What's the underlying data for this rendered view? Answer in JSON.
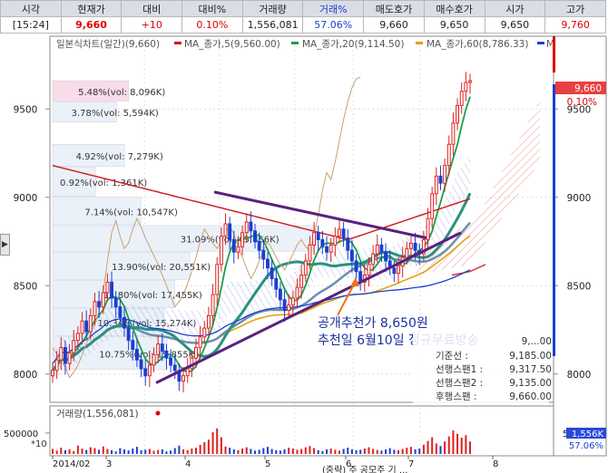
{
  "quote_bar": {
    "headers": [
      "시각",
      "현재가",
      "대비",
      "대비%",
      "거래량",
      "거래%",
      "매도호가",
      "매수호가",
      "시가",
      "고가"
    ],
    "values": [
      "[15:24]",
      "9,660",
      "+10",
      "0.10%",
      "1,556,081",
      "57.06%",
      "9,660",
      "9,650",
      "9,650",
      "9,760"
    ],
    "value_colors": [
      "#222222",
      "#e00000",
      "#e00000",
      "#e00000",
      "#222222",
      "#1a3fd0",
      "#222222",
      "#222222",
      "#222222",
      "#e00000"
    ]
  },
  "legend": {
    "items": [
      {
        "label": "일본식차트(일간)(9,660)",
        "color": "#666666"
      },
      {
        "label": "MA_종가,5(9,560.00)",
        "color": "#e00000"
      },
      {
        "label": "MA_종가,20(9,114.50)",
        "color": "#1aa04a"
      },
      {
        "label": "MA_종가,60(8,786.33)",
        "color": "#e0a000"
      },
      {
        "label": "M",
        "color": "#1a3fd0"
      }
    ]
  },
  "price_badge": {
    "price": "9,660",
    "pct": "0.10%"
  },
  "annotations": {
    "line1": "공개추천가 8,650원",
    "line2": "추천일 6월10일 정규무료방송"
  },
  "info_box": {
    "rows": [
      {
        "label": "",
        "value": "9,...00"
      },
      {
        "label": "기준선 :",
        "value": "9,185.00"
      },
      {
        "label": "선행스팬1 :",
        "value": "9,317.50"
      },
      {
        "label": "선행스팬2 :",
        "value": "9,135.00"
      },
      {
        "label": "후행스팬 :",
        "value": "9,660.00"
      }
    ]
  },
  "volume_panel": {
    "title": "거래량(1,556,081)",
    "multiplier": "*10",
    "badge_value": "1,556K",
    "badge_pct": "57.06%"
  },
  "x_labels": [
    "2014/02",
    "3",
    "4",
    "5",
    "6",
    "7",
    "8"
  ],
  "bottom_text": "(중략) 주 공모주 기 ...",
  "chart_data": {
    "type": "candlestick",
    "title": "",
    "ylim": [
      7850,
      9850
    ],
    "y_ticks": [
      8000,
      8500,
      9000,
      9500
    ],
    "y_tick_labels": [
      "8000",
      "8500",
      "9000",
      "9500"
    ],
    "volume_ticks": [
      500000
    ],
    "volume_tick_labels": [
      "500000"
    ],
    "volume_right_label": "500000",
    "volume_ylim": [
      0,
      800000
    ],
    "series_close": [
      8020,
      8080,
      8150,
      8060,
      8120,
      8190,
      8230,
      8300,
      8240,
      8330,
      8410,
      8380,
      8460,
      8520,
      8430,
      8380,
      8320,
      8260,
      8190,
      8140,
      8080,
      8030,
      7990,
      8050,
      8110,
      8170,
      8130,
      8090,
      8050,
      8020,
      7960,
      7990,
      8030,
      8090,
      8150,
      8210,
      8260,
      8330,
      8450,
      8620,
      8780,
      8850,
      8760,
      8690,
      8720,
      8800,
      8860,
      8810,
      8750,
      8700,
      8650,
      8600,
      8540,
      8480,
      8420,
      8360,
      8390,
      8430,
      8490,
      8560,
      8640,
      8730,
      8800,
      8760,
      8720,
      8690,
      8730,
      8780,
      8820,
      8770,
      8700,
      8640,
      8580,
      8520,
      8560,
      8620,
      8680,
      8730,
      8690,
      8640,
      8600,
      8570,
      8610,
      8660,
      8710,
      8740,
      8700,
      8680,
      8760,
      8880,
      9020,
      9120,
      9080,
      9180,
      9300,
      9420,
      9520,
      9600,
      9650,
      9660
    ],
    "series_volume": [
      120000,
      80000,
      150000,
      90000,
      110000,
      70000,
      200000,
      130000,
      95000,
      160000,
      140000,
      100000,
      180000,
      120000,
      90000,
      60000,
      140000,
      110000,
      85000,
      130000,
      170000,
      90000,
      100000,
      120000,
      75000,
      95000,
      110000,
      60000,
      80000,
      140000,
      200000,
      110000,
      90000,
      130000,
      150000,
      220000,
      280000,
      340000,
      520000,
      610000,
      400000,
      180000,
      150000,
      110000,
      90000,
      130000,
      160000,
      120000,
      80000,
      100000,
      140000,
      170000,
      120000,
      90000,
      80000,
      110000,
      150000,
      130000,
      100000,
      120000,
      160000,
      190000,
      140000,
      90000,
      70000,
      110000,
      130000,
      100000,
      80000,
      120000,
      150000,
      110000,
      90000,
      100000,
      130000,
      160000,
      120000,
      95000,
      80000,
      110000,
      140000,
      100000,
      90000,
      120000,
      150000,
      170000,
      110000,
      130000,
      220000,
      310000,
      400000,
      250000,
      190000,
      300000,
      420000,
      560000,
      480000,
      390000,
      450000,
      300000
    ],
    "cloud_boxes": [
      {
        "label": "5.48%(vol: 8,096K)",
        "y0": 9540,
        "y1": 9660,
        "pink": true
      },
      {
        "label": "3.78%(vol: 5,594K)",
        "y0": 9420,
        "y1": 9540,
        "pink": false
      },
      {
        "label": "4.92%(vol: 7,279K)",
        "y0": 9170,
        "y1": 9300,
        "pink": false
      },
      {
        "label": "0.92%(vol: 1,361K)",
        "y0": 9000,
        "y1": 9170,
        "pink": false
      },
      {
        "label": "7.14%(vol: 10,547K)",
        "y0": 8840,
        "y1": 9000,
        "pink": false
      },
      {
        "label": "31.09%(vol: 45,866K)",
        "y0": 8690,
        "y1": 8840,
        "pink": false
      },
      {
        "label": "13.90%(vol: 20,551K)",
        "y0": 8530,
        "y1": 8690,
        "pink": false
      },
      {
        "label": "11.80%(vol: 17,455K)",
        "y0": 8370,
        "y1": 8530,
        "pink": false
      },
      {
        "label": "10.34%(vol: 15,274K)",
        "y0": 8210,
        "y1": 8370,
        "pink": false
      },
      {
        "label": "10.75%(vol: 15,855K)",
        "y0": 8020,
        "y1": 8210,
        "pink": false
      }
    ]
  }
}
